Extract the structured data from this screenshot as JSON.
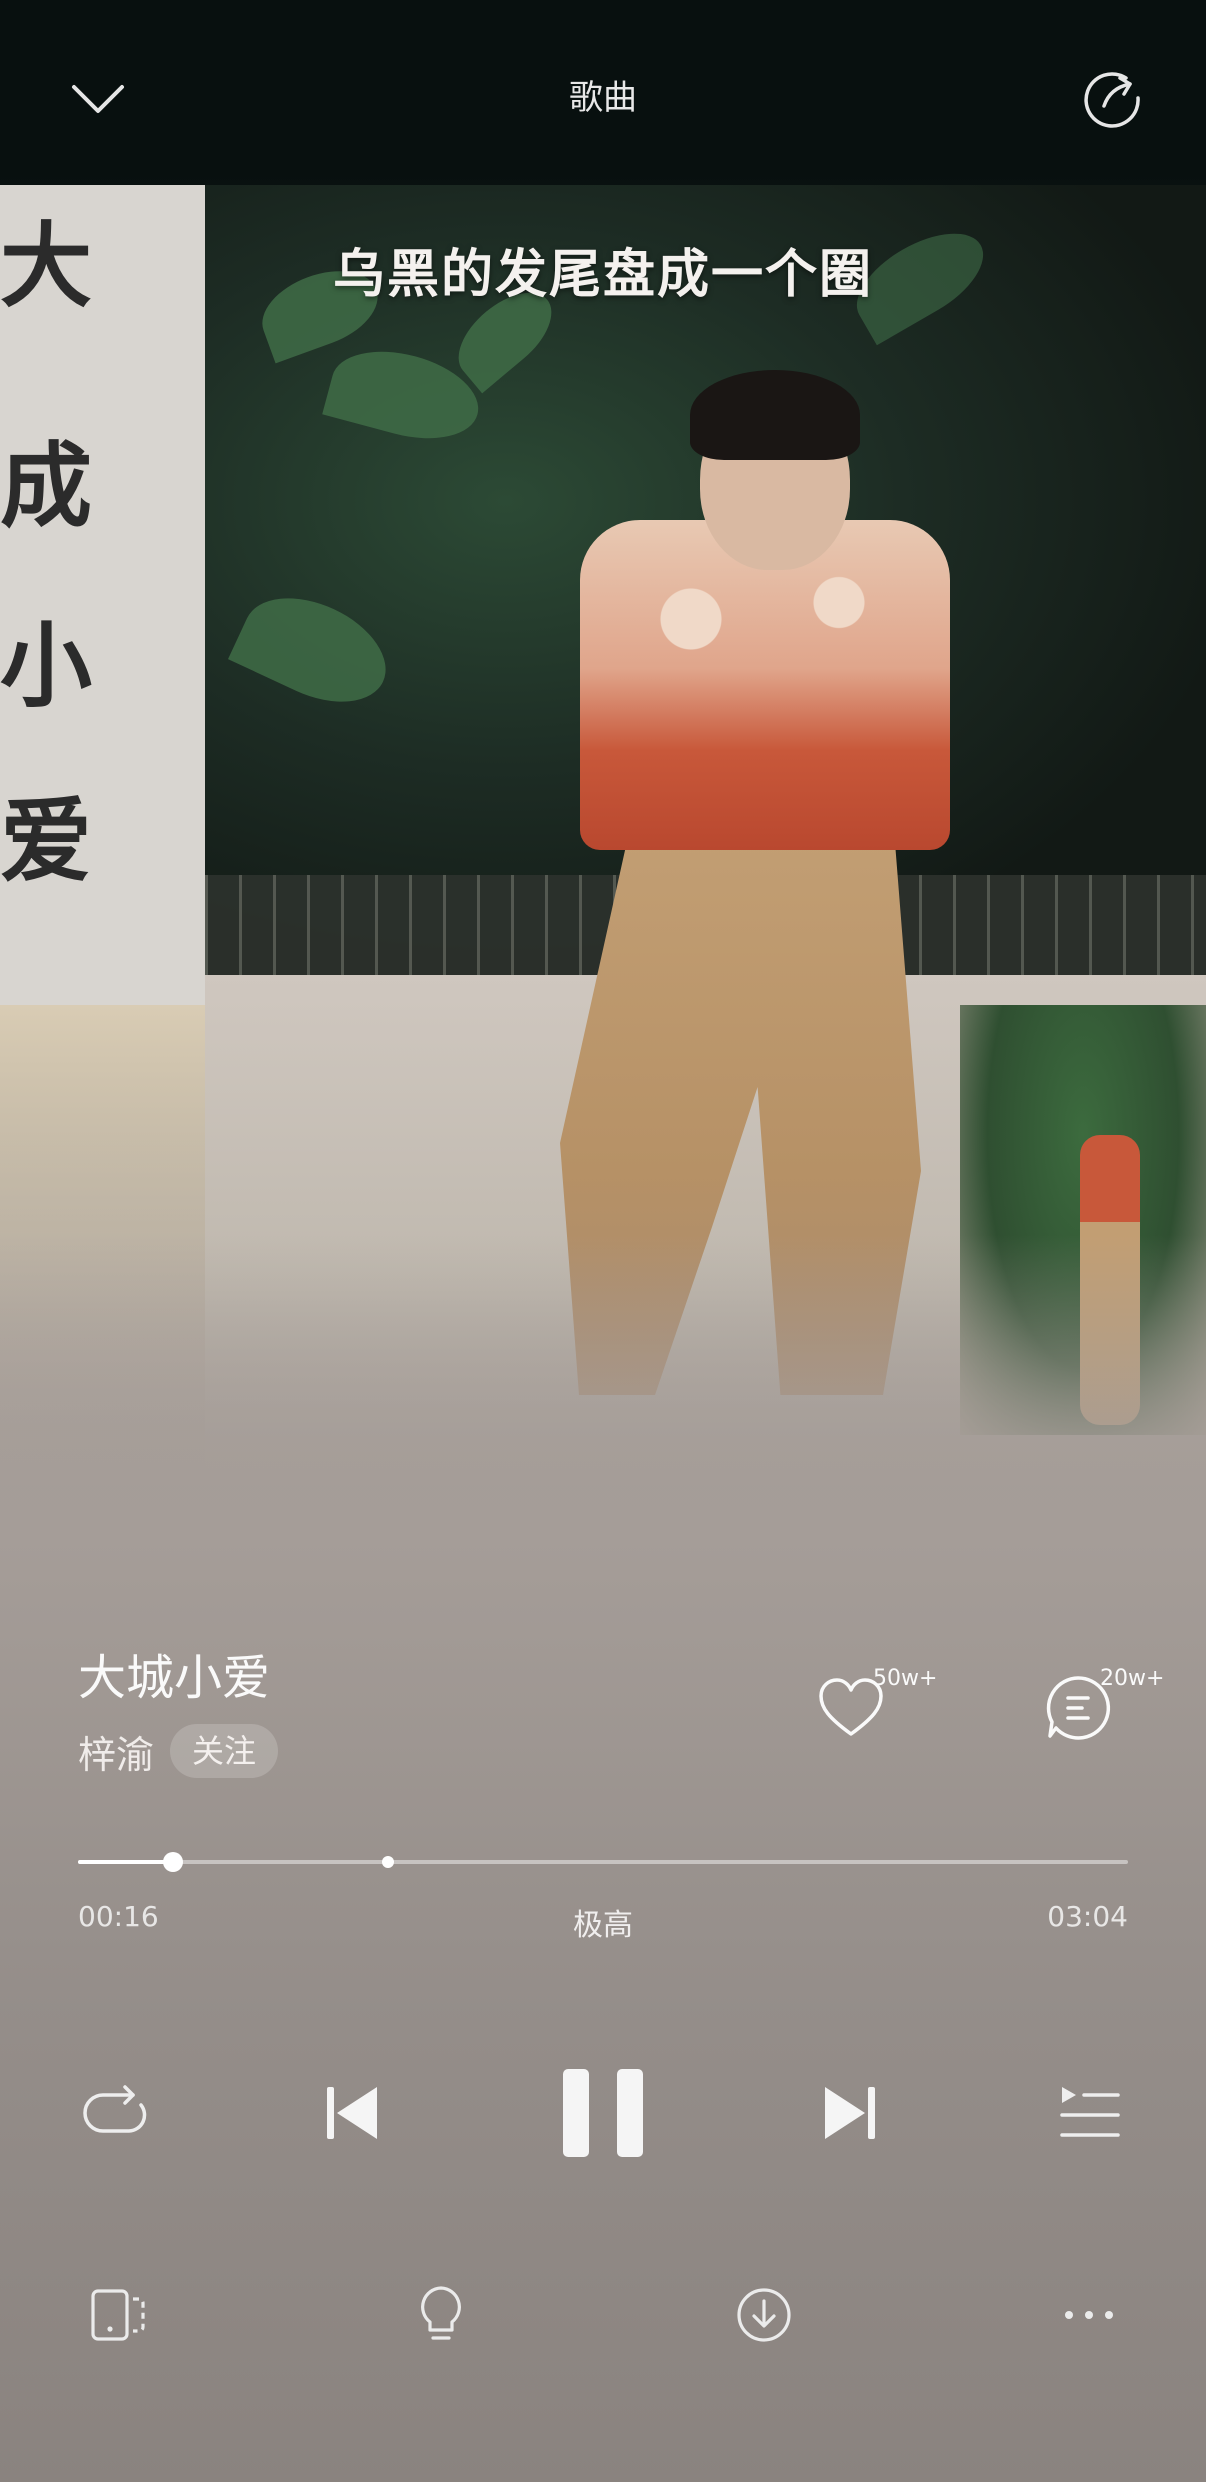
{
  "header": {
    "title": "歌曲",
    "icons": {
      "collapse": "chevron-down-icon",
      "share": "share-icon"
    }
  },
  "lyric": {
    "current_line": "乌黑的发尾盘成一个圈"
  },
  "album_art": {
    "cover_text": [
      "大",
      "成",
      "小",
      "爱"
    ]
  },
  "song": {
    "title": "大城小爱",
    "artist": "梓渝",
    "follow_label": "关注",
    "likes_count": "50w+",
    "comments_count": "20w+"
  },
  "progress": {
    "elapsed": "00:16",
    "duration": "03:04",
    "quality": "极高",
    "played_fraction": 0.09,
    "marker_fraction": 0.295
  },
  "controls": {
    "icons": [
      "repeat-icon",
      "previous-icon",
      "pause-icon",
      "next-icon",
      "playlist-icon"
    ]
  },
  "toolbar": {
    "icons": [
      "device-icon",
      "lightbulb-icon",
      "download-icon",
      "more-icon"
    ]
  },
  "colors": {
    "accent": "#ffffff",
    "top_bg": "#08100f",
    "bottom_bg": "#8a837f"
  }
}
